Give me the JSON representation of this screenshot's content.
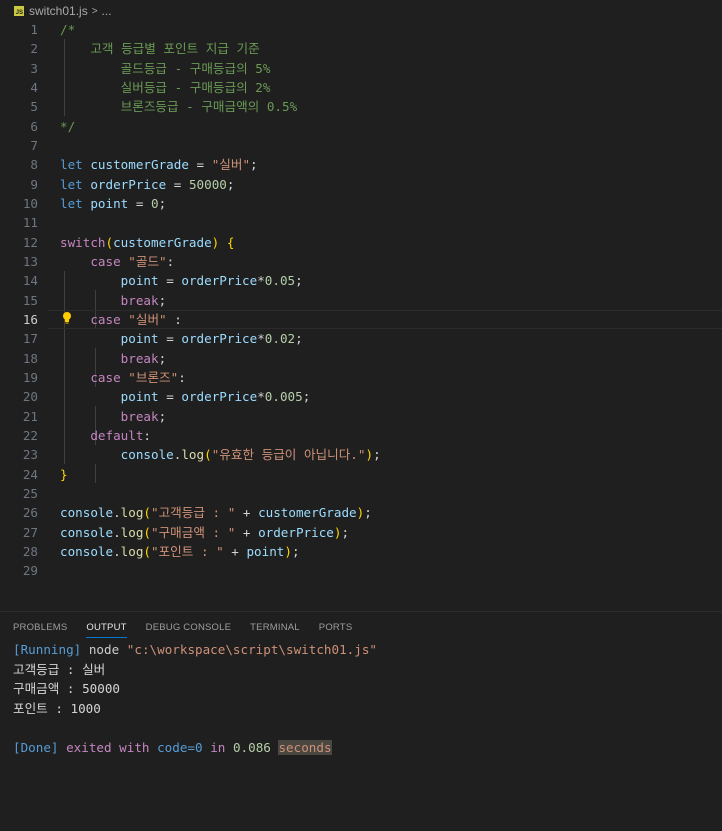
{
  "breadcrumb": {
    "file_icon": "js-file-icon",
    "file": "switch01.js",
    "separator": ">",
    "rest": "..."
  },
  "editor": {
    "current_line": 16,
    "lines": [
      {
        "n": "1",
        "code": "/*"
      },
      {
        "n": "2",
        "code": "    고객 등급별 포인트 지급 기준"
      },
      {
        "n": "3",
        "code": "        골드등급 - 구매등급의 5%"
      },
      {
        "n": "4",
        "code": "        실버등급 - 구매등급의 2%"
      },
      {
        "n": "5",
        "code": "        브론즈등급 - 구매금액의 0.5%"
      },
      {
        "n": "6",
        "code": "*/"
      },
      {
        "n": "7",
        "code": ""
      },
      {
        "n": "8",
        "code": "let customerGrade = \"실버\";"
      },
      {
        "n": "9",
        "code": "let orderPrice = 50000;"
      },
      {
        "n": "10",
        "code": "let point = 0;"
      },
      {
        "n": "11",
        "code": ""
      },
      {
        "n": "12",
        "code": "switch(customerGrade) {"
      },
      {
        "n": "13",
        "code": "    case \"골드\":"
      },
      {
        "n": "14",
        "code": "        point = orderPrice*0.05;"
      },
      {
        "n": "15",
        "code": "        break;"
      },
      {
        "n": "16",
        "code": "    case \"실버\" :"
      },
      {
        "n": "17",
        "code": "        point = orderPrice*0.02;"
      },
      {
        "n": "18",
        "code": "        break;"
      },
      {
        "n": "19",
        "code": "    case \"브론즈\":"
      },
      {
        "n": "20",
        "code": "        point = orderPrice*0.005;"
      },
      {
        "n": "21",
        "code": "        break;"
      },
      {
        "n": "22",
        "code": "    default:"
      },
      {
        "n": "23",
        "code": "        console.log(\"유효한 등급이 아닙니다.\");"
      },
      {
        "n": "24",
        "code": "}"
      },
      {
        "n": "25",
        "code": ""
      },
      {
        "n": "26",
        "code": "console.log(\"고객등급 : \" + customerGrade);"
      },
      {
        "n": "27",
        "code": "console.log(\"구매금액 : \" + orderPrice);"
      },
      {
        "n": "28",
        "code": "console.log(\"포인트 : \" + point);"
      },
      {
        "n": "29",
        "code": ""
      }
    ],
    "lightbulb_icon": "lightbulb-icon"
  },
  "panel": {
    "tabs": [
      {
        "label": "PROBLEMS",
        "active": false
      },
      {
        "label": "OUTPUT",
        "active": true
      },
      {
        "label": "DEBUG CONSOLE",
        "active": false
      },
      {
        "label": "TERMINAL",
        "active": false
      },
      {
        "label": "PORTS",
        "active": false
      }
    ],
    "output": {
      "running_tag": "[Running]",
      "running_cmd": "node",
      "running_path": "\"c:\\workspace\\script\\switch01.js\"",
      "line1": "고객등급 : 실버",
      "line2": "구매금액 : 50000",
      "line3": "포인트 : 1000",
      "done_tag": "[Done]",
      "done_text": "exited with",
      "done_code": "code=0",
      "done_in": "in",
      "done_time": "0.086",
      "done_unit": "seconds"
    }
  },
  "colors": {
    "background": "#1f1f1f",
    "comment": "#6a9955",
    "keyword": "#569cd6",
    "control": "#c586c0",
    "variable": "#9cdcfe",
    "string": "#ce9178",
    "number": "#b5cea8",
    "function": "#dcdcaa",
    "accent": "#0078d4"
  }
}
